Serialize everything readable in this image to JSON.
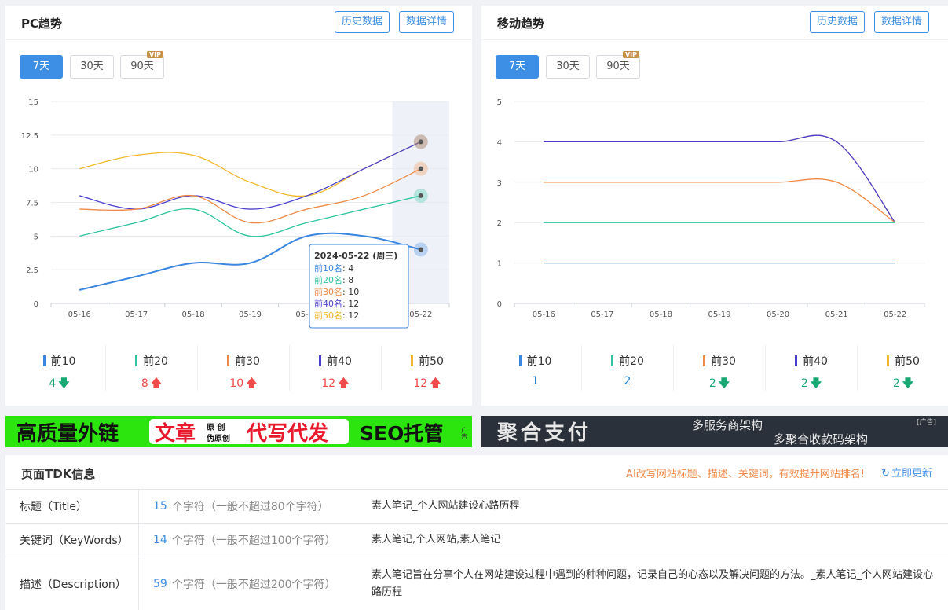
{
  "pc": {
    "title": "PC趋势",
    "history_btn": "历史数据",
    "detail_btn": "数据详情",
    "tabs": [
      "7天",
      "30天",
      "90天"
    ],
    "vip_badge": "VIP",
    "tooltip": {
      "date": "2024-05-22 (周三)",
      "rows": [
        {
          "label": "前10名",
          "value": "4",
          "color": "#3a86e0"
        },
        {
          "label": "前20名",
          "value": "8",
          "color": "#2ec4a0"
        },
        {
          "label": "前30名",
          "value": "10",
          "color": "#ee8a47"
        },
        {
          "label": "前40名",
          "value": "12",
          "color": "#4b3fcf"
        },
        {
          "label": "前50名",
          "value": "12",
          "color": "#f2b82c"
        }
      ]
    },
    "legend": [
      {
        "name": "前10",
        "value": "4",
        "trend": "down",
        "color": "#3a86e0"
      },
      {
        "name": "前20",
        "value": "8",
        "trend": "up",
        "color": "#2ec4a0"
      },
      {
        "name": "前30",
        "value": "10",
        "trend": "up",
        "color": "#ee8a47"
      },
      {
        "name": "前40",
        "value": "12",
        "trend": "up",
        "color": "#4b3fcf"
      },
      {
        "name": "前50",
        "value": "12",
        "trend": "up",
        "color": "#f2b82c"
      }
    ]
  },
  "mobile": {
    "title": "移动趋势",
    "history_btn": "历史数据",
    "detail_btn": "数据详情",
    "tabs": [
      "7天",
      "30天",
      "90天"
    ],
    "vip_badge": "VIP",
    "legend": [
      {
        "name": "前10",
        "value": "1",
        "trend": "none",
        "color": "#3a86e0"
      },
      {
        "name": "前20",
        "value": "2",
        "trend": "none",
        "color": "#2ec4a0"
      },
      {
        "name": "前30",
        "value": "2",
        "trend": "down",
        "color": "#ee8a47"
      },
      {
        "name": "前40",
        "value": "2",
        "trend": "down",
        "color": "#4b3fcf"
      },
      {
        "name": "前50",
        "value": "2",
        "trend": "down",
        "color": "#f2b82c"
      }
    ]
  },
  "chart_data": [
    {
      "type": "line",
      "x": [
        "05-16",
        "05-17",
        "05-18",
        "05-19",
        "05-20",
        "05-21",
        "05-22"
      ],
      "ylim": [
        0,
        15
      ],
      "yticks": [
        "0",
        "2.5",
        "5",
        "7.5",
        "10",
        "12.5",
        "15"
      ],
      "grid": true,
      "series": [
        {
          "name": "前10",
          "color": "#3a86e0",
          "values": [
            1,
            2,
            3,
            3,
            5,
            5,
            4
          ]
        },
        {
          "name": "前20",
          "color": "#2ec4a0",
          "values": [
            5,
            6,
            7,
            5,
            6,
            7,
            8
          ]
        },
        {
          "name": "前30",
          "color": "#ee8a47",
          "values": [
            7,
            7,
            8,
            6,
            7,
            8,
            10
          ]
        },
        {
          "name": "前40",
          "color": "#4b3fcf",
          "values": [
            8,
            7,
            8,
            7,
            8,
            10,
            12
          ]
        },
        {
          "name": "前50",
          "color": "#f2b82c",
          "values": [
            10,
            11,
            11,
            9,
            8,
            10,
            12
          ]
        }
      ]
    },
    {
      "type": "line",
      "x": [
        "05-16",
        "05-17",
        "05-18",
        "05-19",
        "05-20",
        "05-21",
        "05-22"
      ],
      "ylim": [
        0,
        5
      ],
      "yticks": [
        "0",
        "1",
        "2",
        "3",
        "4",
        "5"
      ],
      "grid": true,
      "series": [
        {
          "name": "前10",
          "color": "#3a86e0",
          "values": [
            1,
            1,
            1,
            1,
            1,
            1,
            1
          ]
        },
        {
          "name": "前20",
          "color": "#2ec4a0",
          "values": [
            2,
            2,
            2,
            2,
            2,
            2,
            2
          ]
        },
        {
          "name": "前30",
          "color": "#ee8a47",
          "values": [
            3,
            3,
            3,
            3,
            3,
            3,
            2
          ]
        },
        {
          "name": "前40",
          "color": "#4b3fcf",
          "values": [
            4,
            4,
            4,
            4,
            4,
            4,
            2
          ]
        },
        {
          "name": "前50",
          "color": "#f2b82c",
          "values": [
            4,
            4,
            4,
            4,
            4,
            4,
            2
          ]
        }
      ]
    }
  ],
  "ads": {
    "left": {
      "part1": "高质量外链",
      "part2": "文章",
      "part3a": "原 创",
      "part3b": "伪原创",
      "part4": "代写代发",
      "part5": "SEO托管",
      "ad_tag": "广告"
    },
    "right": {
      "title": "聚合支付",
      "line1": "多服务商架构",
      "line2": "多聚合收款码架构",
      "ad_tag": "[广告]"
    }
  },
  "tdk": {
    "title": "页面TDK信息",
    "ai_tip": "AI改写网站标题、描述、关键词，有效提升网站排名!",
    "refresh": "立即更新",
    "rows": [
      {
        "label": "标题（Title）",
        "count": "15",
        "limit": "个字符（一般不超过80个字符）",
        "content": "素人笔记_个人网站建设心路历程"
      },
      {
        "label": "关键词（KeyWords）",
        "count": "14",
        "limit": "个字符（一般不超过100个字符）",
        "content": "素人笔记,个人网站,素人笔记"
      },
      {
        "label": "描述（Description）",
        "count": "59",
        "limit": "个字符（一般不超过200个字符）",
        "content": "素人笔记旨在分享个人在网站建设过程中遇到的种种问题，记录自己的心态以及解决问题的方法。_素人笔记_个人网站建设心路历程"
      }
    ]
  }
}
